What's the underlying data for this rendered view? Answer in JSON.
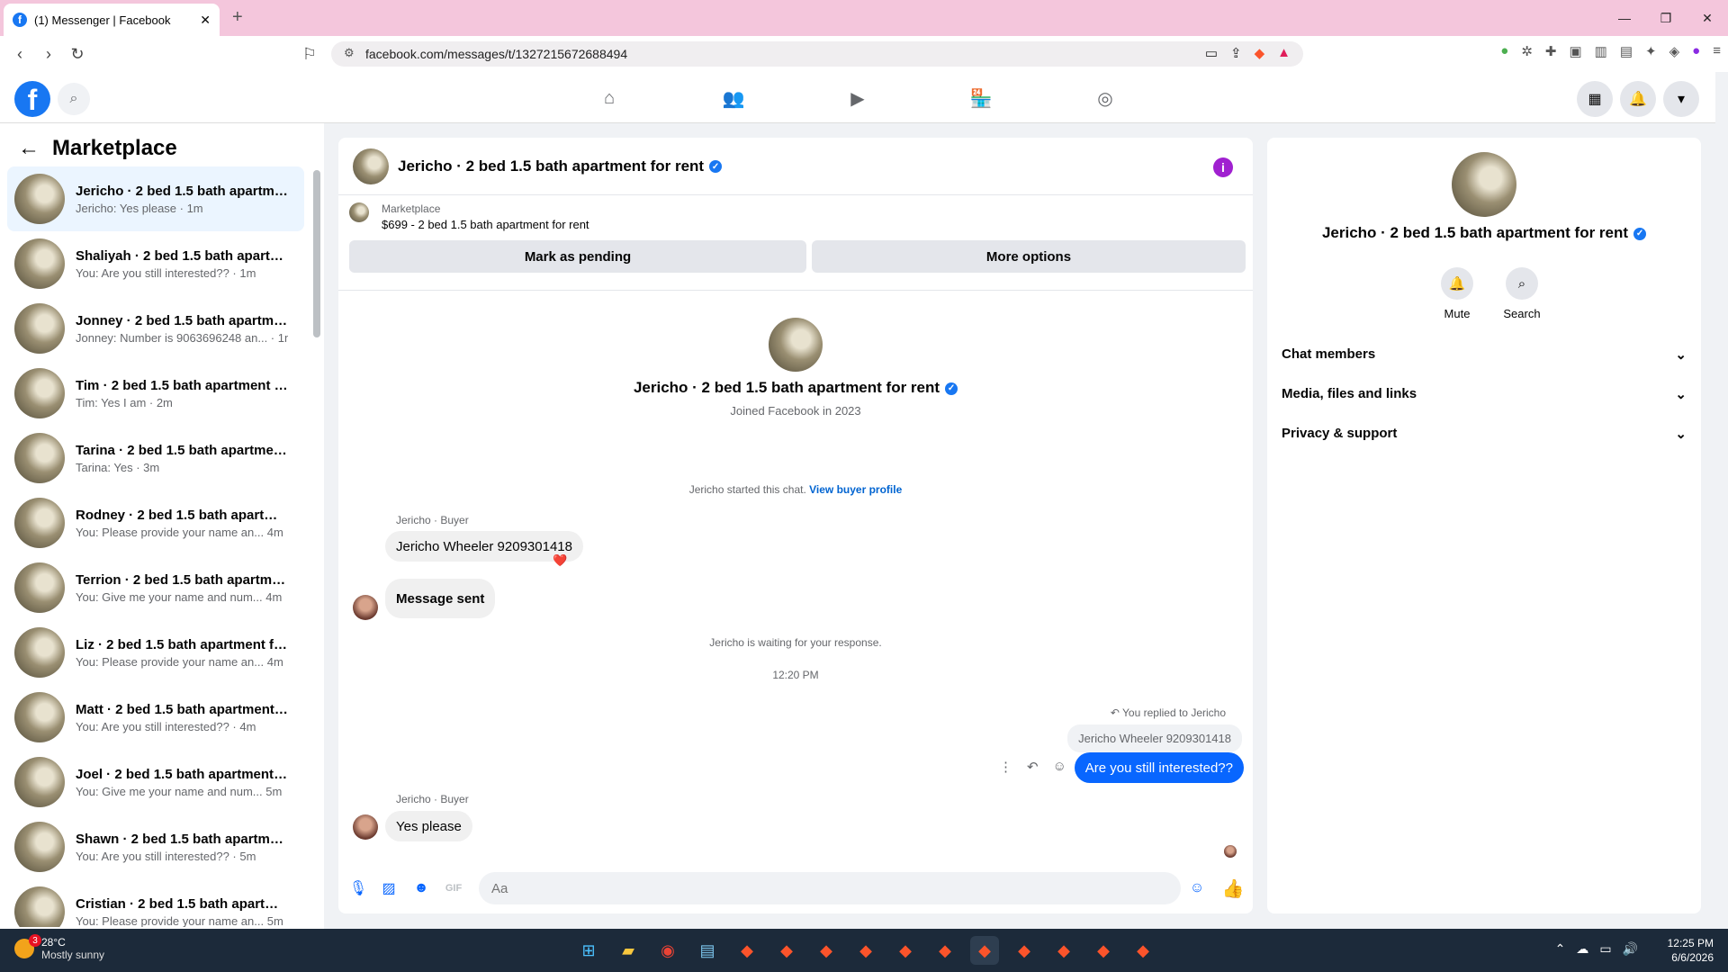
{
  "browser": {
    "tab_title": "(1) Messenger | Facebook",
    "url": "facebook.com/messages/t/1327215672688494"
  },
  "sidebar": {
    "title": "Marketplace",
    "conversations": [
      {
        "name": "Jericho · 2 bed 1.5 bath apartme...",
        "preview": "Jericho: Yes please · 1m",
        "active": true
      },
      {
        "name": "Shaliyah · 2 bed 1.5 bath apartm...",
        "preview": "You: Are you still interested?? · 1m"
      },
      {
        "name": "Jonney · 2 bed 1.5 bath apartme...",
        "preview": "Jonney: Number is 9063696248 an... · 1m"
      },
      {
        "name": "Tim · 2 bed 1.5 bath apartment f...",
        "preview": "Tim: Yes I am · 2m"
      },
      {
        "name": "Tarina · 2 bed 1.5 bath apartmen...",
        "preview": "Tarina: Yes · 3m"
      },
      {
        "name": "Rodney · 2 bed 1.5 bath apartme...",
        "preview": "You: Please provide your name an...   4m"
      },
      {
        "name": "Terrion · 2 bed 1.5 bath apartme...",
        "preview": "You: Give me your name and num...   4m"
      },
      {
        "name": "Liz · 2 bed 1.5 bath apartment fo...",
        "preview": "You: Please provide your name an...   4m"
      },
      {
        "name": "Matt · 2 bed 1.5 bath apartment ...",
        "preview": "You: Are you still interested?? · 4m"
      },
      {
        "name": "Joel · 2 bed 1.5 bath apartment f...",
        "preview": "You: Give me your name and num...   5m"
      },
      {
        "name": "Shawn · 2 bed 1.5 bath apartme...",
        "preview": "You: Are you still interested?? · 5m"
      },
      {
        "name": "Cristian · 2 bed 1.5 bath apartme...",
        "preview": "You: Please provide your name an...   5m"
      }
    ]
  },
  "chat": {
    "title": "Jericho · 2 bed 1.5 bath apartment for rent",
    "marketplace_label": "Marketplace",
    "listing": "$699 - 2 bed 1.5 bath apartment for rent",
    "mark_pending": "Mark as pending",
    "more_options": "More options",
    "profile_name": "Jericho · 2 bed 1.5 bath apartment for rent",
    "joined": "Joined Facebook in 2023",
    "started_text": "Jericho started this chat.",
    "view_buyer_profile": "View buyer profile",
    "sender_label": "Jericho · Buyer",
    "msg1": "Jericho Wheeler 9209301418",
    "msg1_reaction": "❤️",
    "msg2": "Message sent",
    "waiting": "Jericho is waiting for your response.",
    "timestamp": "12:20 PM",
    "replied_to": "You replied to Jericho",
    "quoted": "Jericho Wheeler 9209301418",
    "my_msg": "Are you still interested??",
    "sender_label2": "Jericho · Buyer",
    "msg3": "Yes please",
    "input_placeholder": "Aa"
  },
  "right_panel": {
    "name": "Jericho · 2 bed 1.5 bath apartment for rent",
    "mute": "Mute",
    "search": "Search",
    "sections": [
      "Chat members",
      "Media, files and links",
      "Privacy & support"
    ]
  },
  "taskbar": {
    "temp": "28°C",
    "weather": "Mostly sunny",
    "weather_badge": "3",
    "time": "12:25 PM",
    "date": "6/6/2026"
  },
  "colors": {
    "brand": "#1877f2",
    "message_blue": "#0866ff",
    "tab_bar": "#f4c6dc"
  }
}
